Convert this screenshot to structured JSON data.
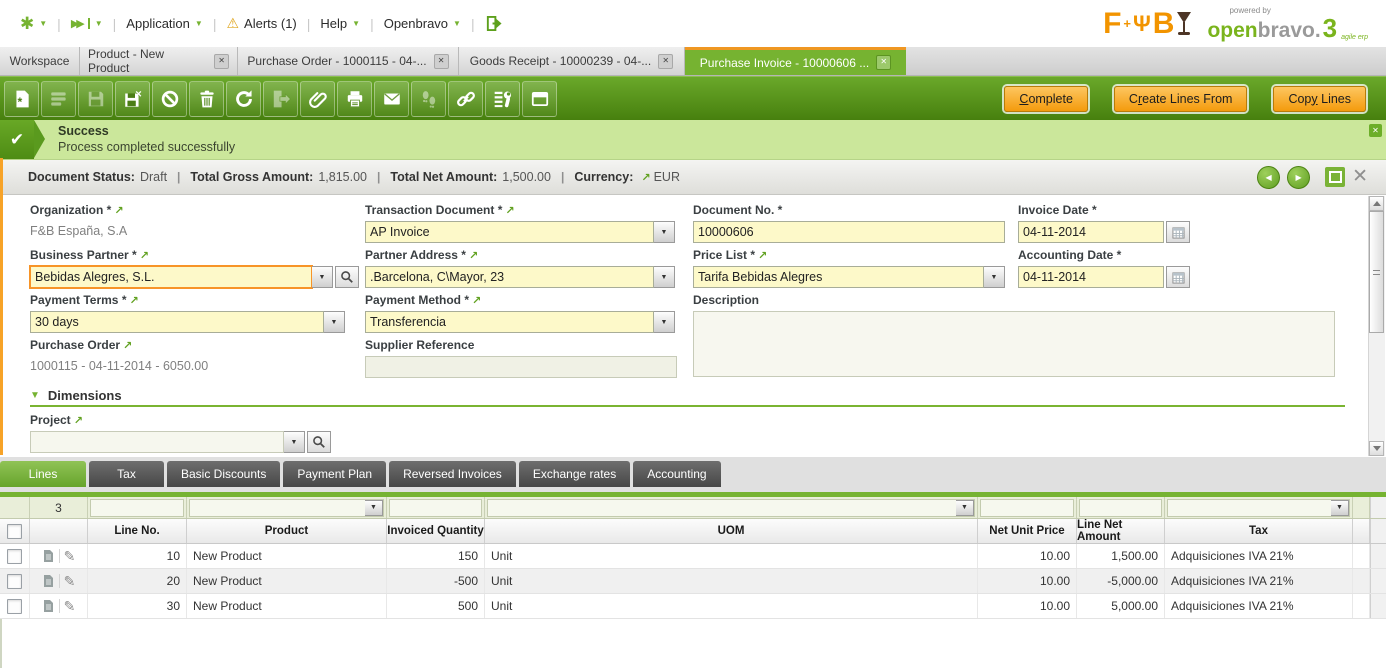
{
  "icons": {
    "caret_down": "▼",
    "workspace_star": "✱",
    "fast_forward": "▶▶",
    "alert_triangle": "⚠",
    "check": "✔",
    "close": "✕",
    "link_arrow": "↗",
    "prev_arrow": "◀",
    "next_arrow": "▶",
    "pencil": "✎",
    "section_caret": "▼",
    "fork": "Ψ",
    "new_star": "*"
  },
  "menubar": {
    "application": "Application",
    "alerts": "Alerts (1)",
    "help": "Help",
    "openbravo": "Openbravo"
  },
  "logo": {
    "f": "F",
    "plus": "+",
    "b": "B",
    "powered_by": "powered by",
    "open": "open",
    "bravo": "bravo.",
    "version": "3",
    "tagline": "agile erp"
  },
  "tabs": [
    {
      "label": "Workspace"
    },
    {
      "label": "Product - New Product"
    },
    {
      "label": "Purchase Order - 1000115 - 04-..."
    },
    {
      "label": "Goods Receipt - 10000239 - 04-..."
    },
    {
      "label": "Purchase Invoice - 10000606 ..."
    }
  ],
  "toolbar": {
    "icon_names": [
      "new-document",
      "edit-in-grid",
      "save",
      "save-and-close",
      "undo",
      "delete",
      "refresh",
      "export",
      "attachment",
      "print",
      "email",
      "audit-trail",
      "link",
      "process",
      "form-view"
    ],
    "buttons": [
      {
        "pre": "",
        "u": "C",
        "post": "omplete"
      },
      {
        "pre": "C",
        "u": "r",
        "post": "eate Lines From"
      },
      {
        "pre": "Cop",
        "u": "y",
        "post": " Lines"
      }
    ]
  },
  "message": {
    "title": "Success",
    "text": "Process completed successfully"
  },
  "statusbar": {
    "document_status_label": "Document Status:",
    "document_status": "Draft",
    "gross_label": "Total Gross Amount:",
    "gross": "1,815.00",
    "net_label": "Total Net Amount:",
    "net": "1,500.00",
    "currency_label": "Currency:",
    "currency": "EUR"
  },
  "form": {
    "organization": {
      "label": "Organization *",
      "value": "F&B España, S.A"
    },
    "transaction_document": {
      "label": "Transaction Document *",
      "value": "AP Invoice"
    },
    "document_no": {
      "label": "Document No. *",
      "value": "10000606"
    },
    "invoice_date": {
      "label": "Invoice Date *",
      "value": "04-11-2014"
    },
    "business_partner": {
      "label": "Business Partner *",
      "value": "Bebidas Alegres, S.L."
    },
    "partner_address": {
      "label": "Partner Address *",
      "value": ".Barcelona, C\\Mayor, 23"
    },
    "price_list": {
      "label": "Price List *",
      "value": "Tarifa Bebidas Alegres"
    },
    "accounting_date": {
      "label": "Accounting Date *",
      "value": "04-11-2014"
    },
    "payment_terms": {
      "label": "Payment Terms *",
      "value": "30 days"
    },
    "payment_method": {
      "label": "Payment Method *",
      "value": "Transferencia"
    },
    "description": {
      "label": "Description",
      "value": ""
    },
    "purchase_order": {
      "label": "Purchase Order",
      "value": "1000115 - 04-11-2014 - 6050.00"
    },
    "supplier_reference": {
      "label": "Supplier Reference",
      "value": ""
    },
    "dimensions_section": "Dimensions",
    "project": {
      "label": "Project",
      "value": ""
    }
  },
  "child_tabs": [
    {
      "label": "Lines"
    },
    {
      "label": "Tax"
    },
    {
      "label": "Basic Discounts"
    },
    {
      "label": "Payment Plan"
    },
    {
      "label": "Reversed Invoices"
    },
    {
      "label": "Exchange rates"
    },
    {
      "label": "Accounting"
    }
  ],
  "grid": {
    "count": "3",
    "headers": {
      "line_no": "Line No.",
      "product": "Product",
      "invoiced_quantity": "Invoiced Quantity",
      "uom": "UOM",
      "net_unit_price": "Net Unit Price",
      "line_net_amount": "Line Net Amount",
      "tax": "Tax"
    },
    "rows": [
      {
        "line_no": "10",
        "product": "New Product",
        "invoiced_quantity": "150",
        "uom": "Unit",
        "net_unit_price": "10.00",
        "line_net_amount": "1,500.00",
        "tax": "Adquisiciones IVA 21%"
      },
      {
        "line_no": "20",
        "product": "New Product",
        "invoiced_quantity": "-500",
        "uom": "Unit",
        "net_unit_price": "10.00",
        "line_net_amount": "-5,000.00",
        "tax": "Adquisiciones IVA 21%"
      },
      {
        "line_no": "30",
        "product": "New Product",
        "invoiced_quantity": "500",
        "uom": "Unit",
        "net_unit_price": "10.00",
        "line_net_amount": "5,000.00",
        "tax": "Adquisiciones IVA 21%"
      }
    ]
  },
  "colors": {
    "accent_green": "#76b331",
    "toolbar_green": "#57901c",
    "button_orange": "#f49b0d",
    "success_bg": "#cbe79b",
    "required_field_bg": "#fdf9c9",
    "focus_border_orange": "#f79428"
  }
}
